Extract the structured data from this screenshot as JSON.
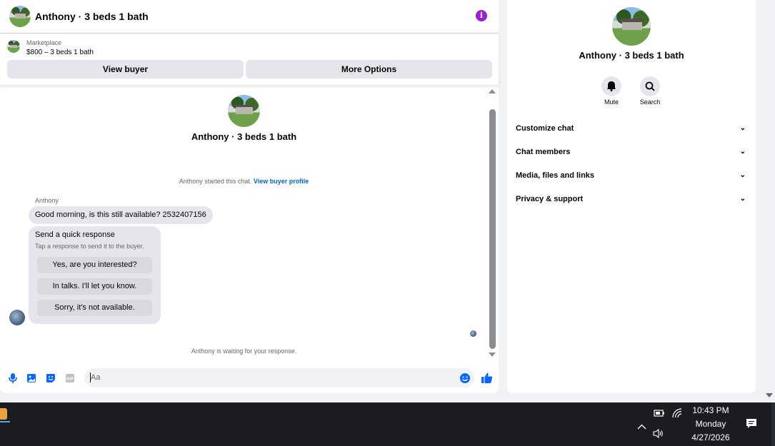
{
  "header": {
    "title": "Anthony · 3 beds 1 bath",
    "info_icon": "info-icon"
  },
  "listing": {
    "label": "Marketplace",
    "price_title": "$800 – 3 beds 1 bath"
  },
  "actions": {
    "view_buyer": "View buyer",
    "more_options": "More Options"
  },
  "conversation": {
    "name": "Anthony · 3 beds 1 bath",
    "started_text": "Anthony started this chat.",
    "started_link": "View buyer profile",
    "sender": "Anthony",
    "message": "Good morning, is this still available? 2532407156",
    "quick_title": "Send a quick response",
    "quick_subtitle": "Tap a response to send it to the buyer.",
    "quick_options": [
      "Yes, are you interested?",
      "In talks. I'll let you know.",
      "Sorry, it's not available."
    ],
    "waiting": "Anthony is waiting for your response."
  },
  "composer": {
    "placeholder": "Aa"
  },
  "info_panel": {
    "name": "Anthony · 3 beds 1 bath",
    "mute": "Mute",
    "search": "Search",
    "sections": [
      "Customize chat",
      "Chat members",
      "Media, files and links",
      "Privacy & support"
    ]
  },
  "taskbar": {
    "time": "10:43 PM",
    "day": "Monday",
    "date": "4/27/2026"
  },
  "colors": {
    "accent": "#0866ff",
    "info": "#9b1ed4"
  }
}
